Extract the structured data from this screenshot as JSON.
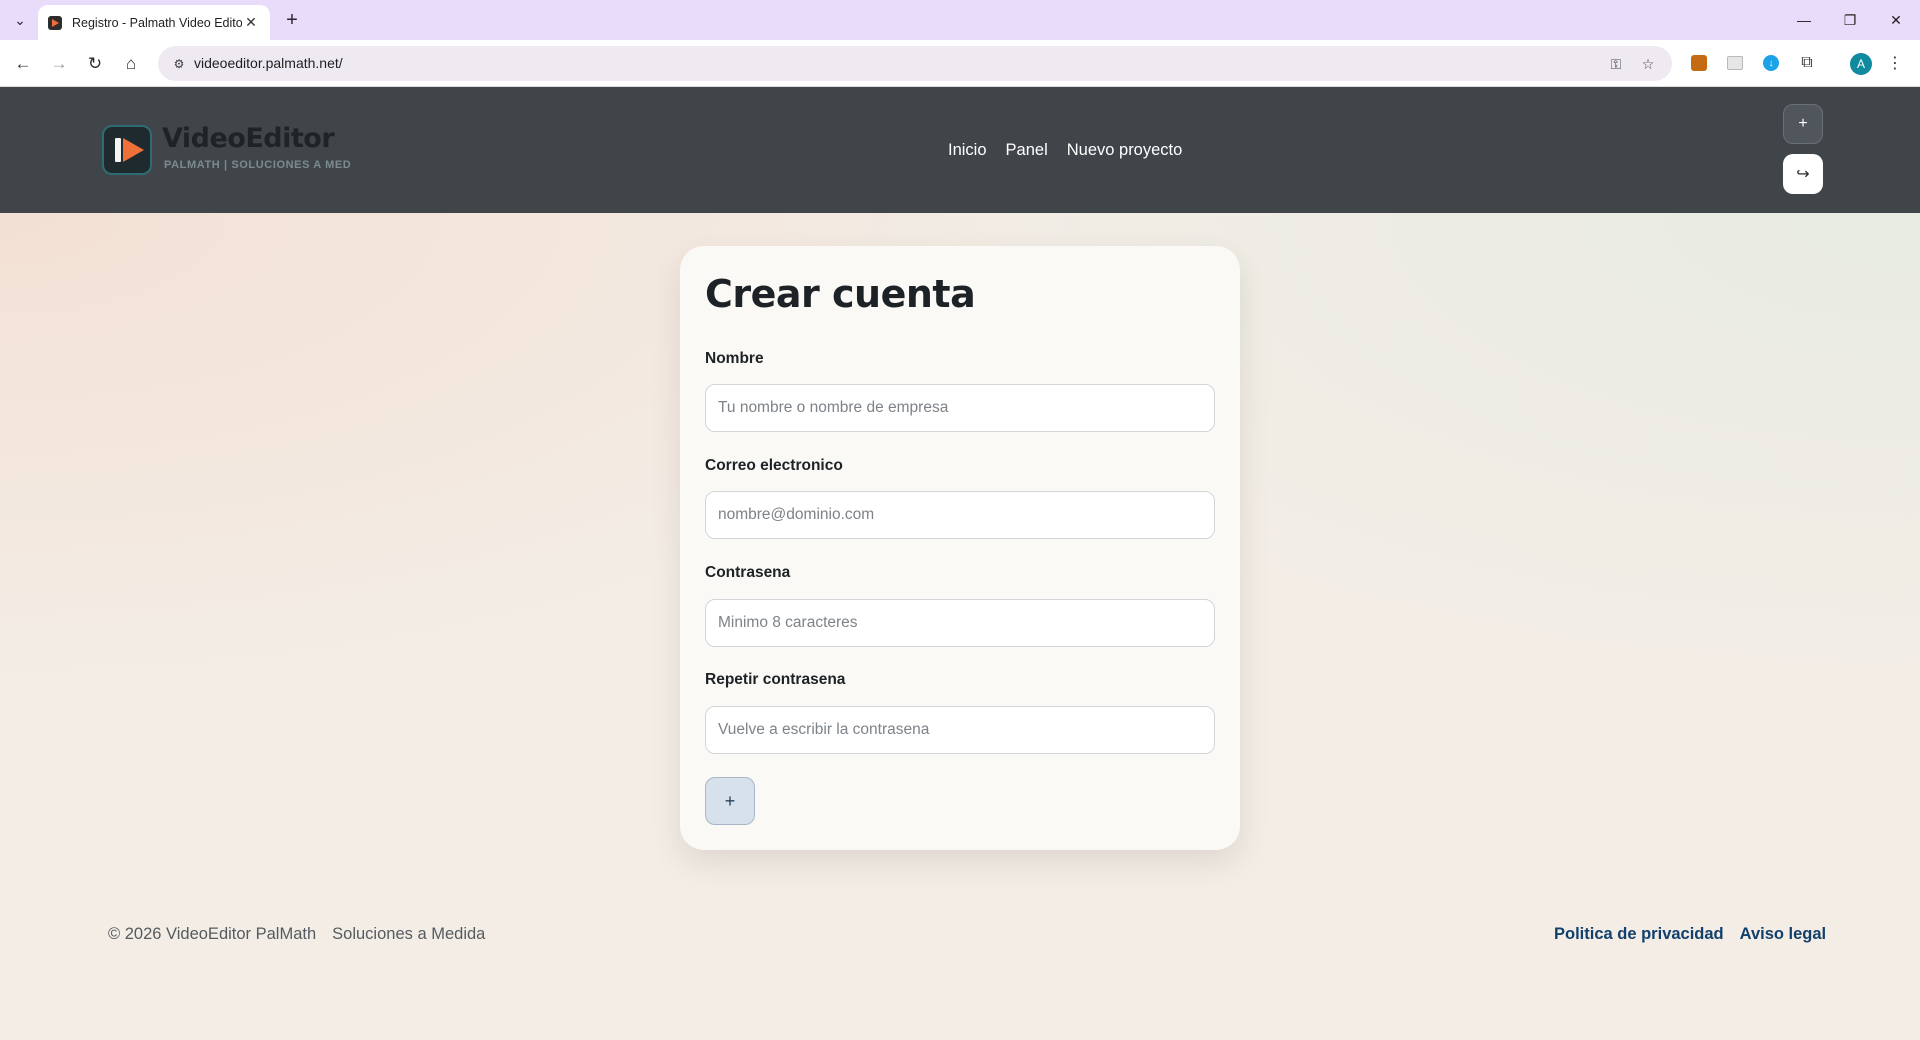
{
  "browser": {
    "tab_title": "Registro - Palmath Video Editor",
    "tab_close": "✕",
    "new_tab": "+",
    "url": "videoeditor.palmath.net/",
    "avatar_initial": "A",
    "icons": [
      "tab-list-icon",
      "favicon-icon",
      "back-icon",
      "forward-icon",
      "reload-icon",
      "home-icon",
      "site-info-icon",
      "password-key-icon",
      "bookmark-star-icon",
      "extension-icon",
      "download-icon",
      "puzzle-icon",
      "menu-dots-icon",
      "minimize-icon",
      "restore-icon",
      "close-icon"
    ]
  },
  "header": {
    "logo_title": "VideoEditor",
    "logo_subtitle": "PALMATH | SOLUCIONES A MED",
    "nav": [
      "Inicio",
      "Panel",
      "Nuevo proyecto"
    ],
    "button_add": "+",
    "button_logout": "↪"
  },
  "form": {
    "title": "Crear cuenta",
    "fields": [
      {
        "label": "Nombre",
        "placeholder": "Tu nombre o nombre de empresa",
        "value": ""
      },
      {
        "label": "Correo electronico",
        "placeholder": "nombre@dominio.com",
        "value": ""
      },
      {
        "label": "Contrasena",
        "placeholder": "Minimo 8 caracteres",
        "value": ""
      },
      {
        "label": "Repetir contrasena",
        "placeholder": "Vuelve a escribir la contrasena",
        "value": ""
      }
    ],
    "submit": "+"
  },
  "footer": {
    "copyright": "© 2026 VideoEditor PalMath",
    "tagline": "Soluciones a Medida",
    "links": [
      "Politica de privacidad",
      "Aviso legal"
    ]
  },
  "colors": {
    "header_bg": "#404549",
    "card_bg": "#fbf9f6",
    "link": "#12406c",
    "logo_accent": "#f0703a"
  }
}
